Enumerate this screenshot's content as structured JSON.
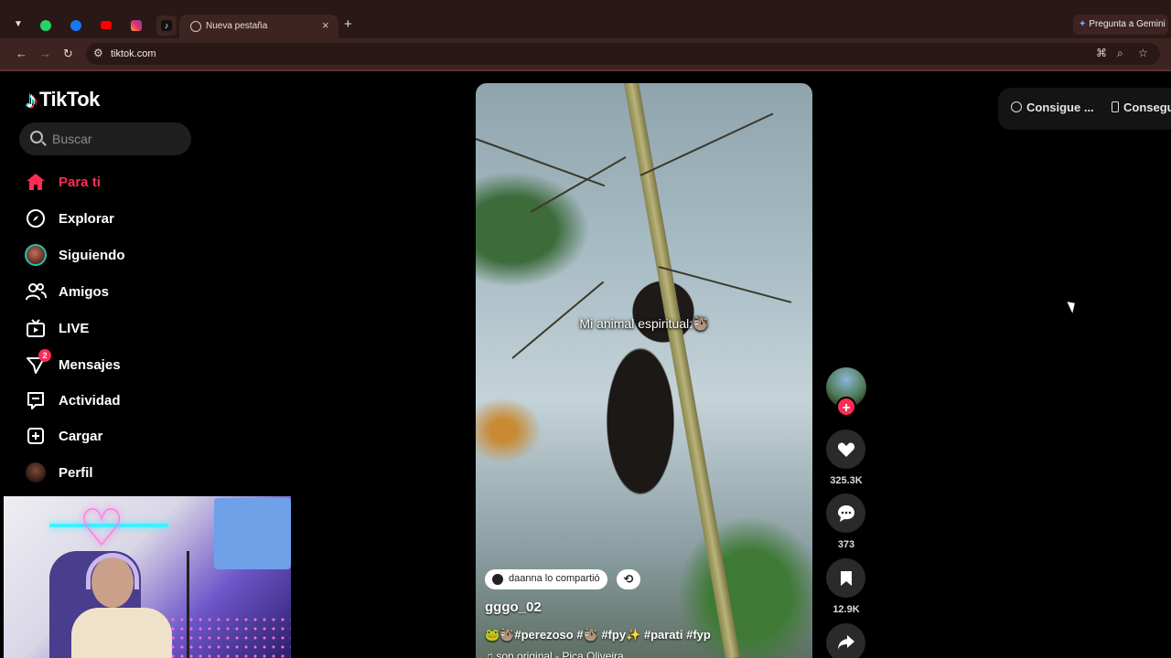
{
  "browser": {
    "tab_dropdown_icon": "chevron-down-icon",
    "pinned_tabs": [
      {
        "name": "whatsapp",
        "color": "#25d366"
      },
      {
        "name": "facebook",
        "color": "#1877f2"
      },
      {
        "name": "youtube",
        "color": "#ff0000"
      },
      {
        "name": "instagram",
        "color": "#e1306c"
      },
      {
        "name": "tiktok",
        "color": "#111111"
      }
    ],
    "active_tab": {
      "title": "Nueva pestaña",
      "close": "×"
    },
    "new_tab": "+",
    "gemini_label": "Pregunta a Gemini",
    "url": "tiktok.com"
  },
  "sidebar": {
    "logo": "TikTok",
    "search_placeholder": "Buscar",
    "items": [
      {
        "label": "Para ti",
        "icon": "home-icon",
        "active": true
      },
      {
        "label": "Explorar",
        "icon": "compass-icon"
      },
      {
        "label": "Siguiendo",
        "icon": "avatar-icon"
      },
      {
        "label": "Amigos",
        "icon": "friends-icon"
      },
      {
        "label": "LIVE",
        "icon": "live-tv-icon"
      },
      {
        "label": "Mensajes",
        "icon": "message-icon",
        "badge": "2"
      },
      {
        "label": "Actividad",
        "icon": "activity-icon"
      },
      {
        "label": "Cargar",
        "icon": "upload-icon"
      },
      {
        "label": "Perfil",
        "icon": "profile-avatar-icon"
      }
    ]
  },
  "video": {
    "caption": "Mi animal espiritual:🦥",
    "shared_by": "daanna lo compartió",
    "username": "gggo_02",
    "hashtags": "🐸🦥#perezoso #🦥 #fpy✨ #parati #fyp",
    "music": "♫ son original - Pica Oliveira"
  },
  "actions": {
    "likes": "325.3K",
    "comments": "373",
    "saves": "12.9K"
  },
  "top_right": {
    "pill_1": "Consigue ...",
    "pill_2": "Consegu"
  },
  "colors": {
    "accent": "#fe2c55",
    "browser_frame": "#2a1816",
    "browser_toolbar": "#3d2422"
  }
}
